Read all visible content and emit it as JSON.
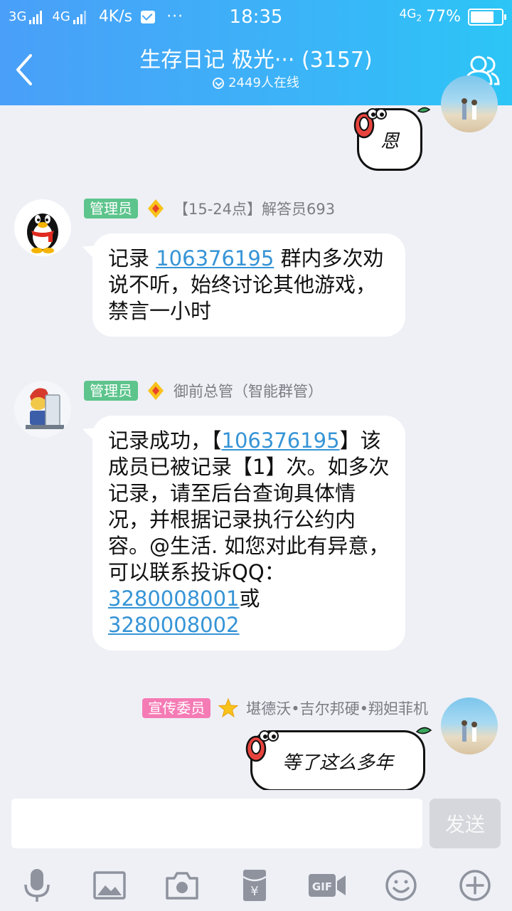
{
  "status_bar": {
    "left_signals": [
      "3G",
      "4G"
    ],
    "speed": "4K/s",
    "dots": "···",
    "time": "18:35",
    "network": "4G",
    "network_sub": "2",
    "battery_percent": "77%",
    "battery_level": 0.77
  },
  "header": {
    "title": "生存日记 极光···  (3157)",
    "online": "2449人在线"
  },
  "messages": [
    {
      "type": "sticker",
      "side": "right",
      "text": "恩",
      "avatar_icon": "couple-photo-avatar"
    },
    {
      "type": "text",
      "side": "left",
      "role_badge": "管理员",
      "role_icon": "diamond-icon",
      "sender": "【15-24点】解答员693",
      "avatar_icon": "qq-penguin-avatar",
      "parts": {
        "p1": "记录 ",
        "p2": "106376195",
        "p3": " 群内多次劝说不听，始终讨论其他游戏，禁言一小时"
      }
    },
    {
      "type": "text",
      "side": "left",
      "role_badge": "管理员",
      "role_icon": "diamond-icon",
      "sender": "御前总管（智能群管）",
      "avatar_icon": "lego-robot-avatar",
      "parts": {
        "p1": "记录成功，【",
        "p2": "106376195",
        "p3": "】该成员已被记录【1】次。如多次记录，请至后台查询具体情况，并根据记录执行公约内容。@生活. 如您对此有异意，可以联系投诉QQ：",
        "p4": "3280008001",
        "p5": "或",
        "p6": "3280008002"
      }
    },
    {
      "type": "sticker",
      "side": "right",
      "role_badge": "宣传委员",
      "role_icon": "star-icon",
      "sender": "堪德沃•吉尔邦硬•翔妲菲机",
      "text": "等了这么多年",
      "avatar_icon": "couple-photo-avatar"
    }
  ],
  "input": {
    "placeholder": "",
    "send_label": "发送"
  },
  "toolbar": [
    "microphone-icon",
    "image-icon",
    "camera-icon",
    "red-packet-icon",
    "gif-icon",
    "emoji-icon",
    "plus-icon"
  ],
  "colors": {
    "header_start": "#4a9ff8",
    "header_end": "#2cc5f6",
    "admin_badge": "#5dc48c",
    "publicity_badge": "#f57bb5",
    "link": "#3694d6",
    "background": "#eef0f5"
  }
}
